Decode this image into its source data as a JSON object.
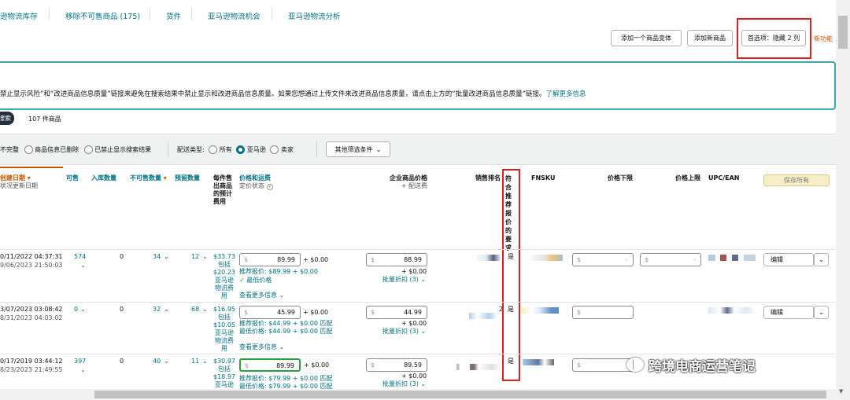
{
  "tabs": [
    {
      "label": "逊物流库存"
    },
    {
      "label": "移除不可售商品 (175)"
    },
    {
      "label": "货件"
    },
    {
      "label": "亚马逊物流机会"
    },
    {
      "label": "亚马逊物流分析"
    }
  ],
  "toolbar": {
    "add_variation": "添加一个商品变体",
    "add_product": "添加新商品",
    "preferences": "首选项：隐藏 2 列",
    "new_feature": "新功能"
  },
  "banner": {
    "text": "禁止显示风险”和“改进商品信息质量”链接来避免在搜索结果中禁止显示和改进商品信息质量。如果您想通过上传文件来改进商品信息质量，请点击上方的“批量改进商品信息质量”链接。",
    "link": "了解更多信息"
  },
  "search": {
    "button": "搜索",
    "count": "107 件商品"
  },
  "filters": {
    "status": [
      {
        "label": "不完整",
        "selected": false
      },
      {
        "label": "商品信息已删除",
        "selected": false
      },
      {
        "label": "已禁止显示搜索结果",
        "selected": false
      }
    ],
    "fulfillment_label": "配送类型:",
    "fulfillment": [
      {
        "label": "所有",
        "selected": false
      },
      {
        "label": "亚马逊",
        "selected": true
      },
      {
        "label": "卖家",
        "selected": false
      }
    ],
    "more": "其他筛选条件"
  },
  "columns": {
    "created": "创建日期",
    "status_updated": "状况更新日期",
    "available": "可售",
    "inbound": "入库数量",
    "unfulfillable": "不可售数量",
    "reserved": "预留数量",
    "fee": "每件售出商品的预计费用",
    "price": "价格和运费",
    "price_status": "定价状态",
    "business_price": "企业商品价格",
    "business_shipping": "+ 配送费",
    "sales_rank": "销售排名",
    "featured_offer": "符合推荐报价的要求",
    "fnsku": "FNSKU",
    "min_price": "价格下限",
    "max_price": "价格上限",
    "upc": "UPC/EAN",
    "save_all": "保存所有"
  },
  "rows": [
    {
      "created": "0/11/2022 04:37:31",
      "updated": "9/06/2023 21:50:03",
      "available": "574",
      "inbound": "0",
      "unfulfillable": "34",
      "reserved": "12",
      "fee": "$33.73",
      "fee_note": "包括",
      "fee2": "$20.23",
      "fee_note2": "亚马逊物流费用",
      "currency": "$",
      "price": "89.99",
      "shipping": "+ $0.00",
      "rec_label": "推荐报价:",
      "rec": "$89.99 + $0.00",
      "low_label": "最低价格",
      "low": "",
      "match": "",
      "more_info": "查看更多信息",
      "biz_price": "88.99",
      "biz_ship": "+ $0.00",
      "tiers": "批量折扣 (3)",
      "rank_suffix": "",
      "featured": "是",
      "edit": "编辑"
    },
    {
      "created": "3/07/2023 03:08:42",
      "updated": "8/31/2023 04:03:02",
      "available": "0",
      "inbound": "0",
      "unfulfillable": "32",
      "reserved": "68",
      "fee": "$16.95",
      "fee_note": "包括",
      "fee2": "$10.05",
      "fee_note2": "亚马逊物流费用",
      "currency": "$",
      "price": "45.99",
      "shipping": "+ $0.00",
      "rec_label": "推荐报价:",
      "rec": "$44.99 + $0.00",
      "low_label": "最低价格:",
      "low": "$44.99 + $0.00",
      "match": "匹配",
      "more_info": "查看更多信息",
      "biz_price": "44.99",
      "biz_ship": "+ $0.00",
      "tiers": "批量折扣 (3)",
      "rank_suffix": "2",
      "featured": "是",
      "edit": "编辑"
    },
    {
      "created": "0/17/2019 03:44:12",
      "updated": "8/23/2023 21:49:55",
      "available": "397",
      "inbound": "0",
      "unfulfillable": "40",
      "reserved": "11",
      "fee": "$30.97",
      "fee_note": "包括",
      "fee2": "$18.97",
      "fee_note2": "亚马逊",
      "currency": "$",
      "price": "89.99",
      "shipping": "+ $0.00",
      "rec_label": "推荐报价:",
      "rec": "$79.99 + $0.00",
      "low_label": "最低价格:",
      "low": "$79.99 + $0.00",
      "match": "匹配",
      "more_info": "",
      "biz_price": "89.59",
      "biz_ship": "+ $0.00",
      "tiers": "批量折扣 (3)",
      "rank_suffix": "",
      "featured": "是",
      "edit": ""
    }
  ],
  "watermark": "跨境电商运营笔记",
  "colors": {
    "link": "#007185",
    "highlight": "#e02020",
    "banner": "#3fa8a8",
    "green": "#2e9e3e"
  }
}
